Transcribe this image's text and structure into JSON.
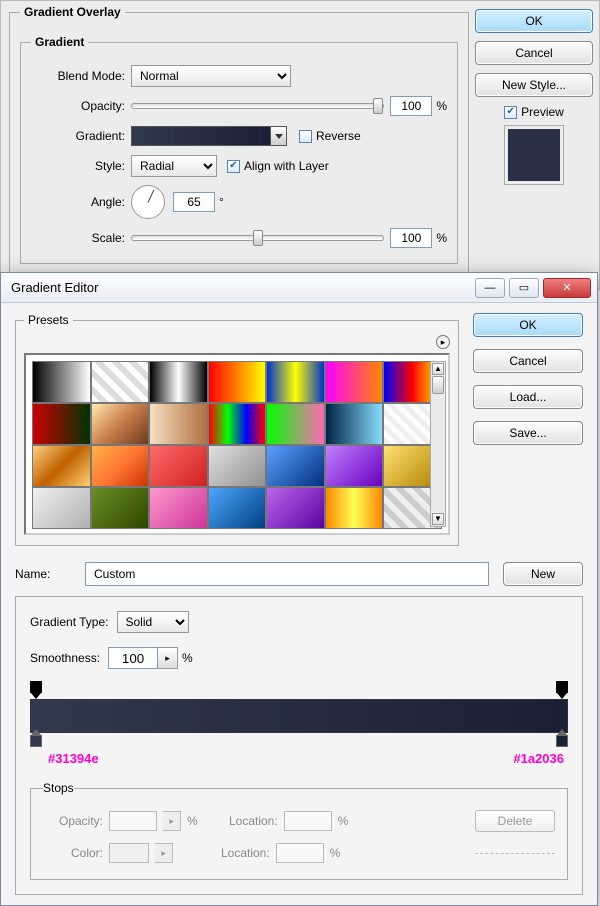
{
  "layerStyle": {
    "title": "Gradient Overlay",
    "groupTitle": "Gradient",
    "labels": {
      "blendMode": "Blend Mode:",
      "opacity": "Opacity:",
      "gradient": "Gradient:",
      "reverse": "Reverse",
      "style": "Style:",
      "alignWithLayer": "Align with Layer",
      "angle": "Angle:",
      "scale": "Scale:"
    },
    "values": {
      "blendMode": "Normal",
      "opacity": "100",
      "opacityUnit": "%",
      "reverseChecked": false,
      "style": "Radial",
      "alignChecked": true,
      "angle": "65",
      "angleUnit": "°",
      "scale": "100",
      "scaleUnit": "%"
    },
    "side": {
      "ok": "OK",
      "cancel": "Cancel",
      "newStyle": "New Style...",
      "preview": "Preview",
      "previewChecked": true
    }
  },
  "gradientEditor": {
    "title": "Gradient Editor",
    "presetsLabel": "Presets",
    "side": {
      "ok": "OK",
      "cancel": "Cancel",
      "load": "Load...",
      "save": "Save..."
    },
    "name": {
      "label": "Name:",
      "value": "Custom",
      "newBtn": "New"
    },
    "gradientType": {
      "label": "Gradient Type:",
      "value": "Solid"
    },
    "smoothness": {
      "label": "Smoothness:",
      "value": "100",
      "unit": "%"
    },
    "bar": {
      "leftHex": "#31394e",
      "rightHex": "#1a2036"
    },
    "stops": {
      "label": "Stops",
      "opacity": "Opacity:",
      "location": "Location:",
      "pct": "%",
      "color": "Color:",
      "delete": "Delete"
    },
    "presets": [
      "linear-gradient(90deg,#000,#fff)",
      "repeating-linear-gradient(45deg,#fff 0 6px,#ddd 6px 12px)",
      "linear-gradient(90deg,#000,#fff,#000)",
      "linear-gradient(90deg,#f00,#ff0)",
      "linear-gradient(90deg,#0033cc,#ff0,#0033cc)",
      "linear-gradient(90deg,#ff00ff,#ff8800)",
      "linear-gradient(90deg,#00f,#f00,#ff0)",
      "linear-gradient(90deg,#cc0000,#003300)",
      "linear-gradient(135deg,#ffe9b0,#c87c4a,#6b3a1d)",
      "linear-gradient(90deg,#f6e0c2,#b07040)",
      "linear-gradient(90deg,#f00,#0f0,#00f,#f00)",
      "linear-gradient(90deg,#0f0,#ff69b4)",
      "linear-gradient(90deg,#002244,#88ddff)",
      "repeating-linear-gradient(45deg,#eee 0 5px,#fff 5px 10px)",
      "linear-gradient(135deg,#ffd080,#c06000,#ffcf70)",
      "linear-gradient(135deg,#ffb347,#ff7733,#cc3300)",
      "linear-gradient(135deg,#ff6a6a,#d02020)",
      "linear-gradient(135deg,#e0e0e0,#909090)",
      "linear-gradient(135deg,#5aa0ff,#003080)",
      "linear-gradient(135deg,#c080ff,#6a00c0)",
      "linear-gradient(135deg,#ffe070,#b08000)",
      "linear-gradient(135deg,#f0f0f0,#b0b0b0)",
      "linear-gradient(135deg,#6b8e23,#2e4600)",
      "linear-gradient(135deg,#ff99cc,#cc3399)",
      "linear-gradient(135deg,#4da6ff,#004080)",
      "linear-gradient(135deg,#bb66ee,#5a00a0)",
      "linear-gradient(90deg,#ff8800,#ffff55,#ff8800)",
      "repeating-linear-gradient(45deg,#ccc 0 6px,#eee 6px 12px)"
    ]
  }
}
